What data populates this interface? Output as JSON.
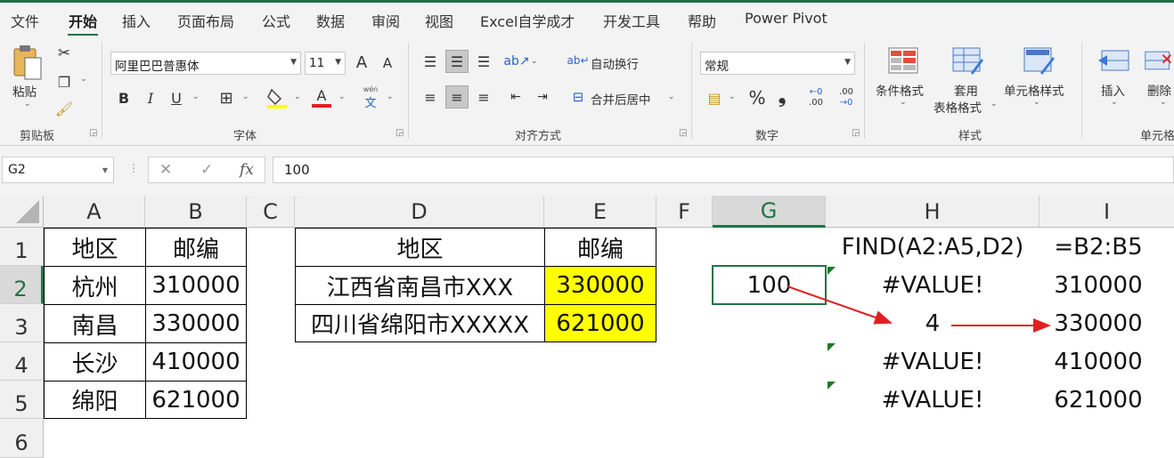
{
  "menu": {
    "items": [
      "文件",
      "开始",
      "插入",
      "页面布局",
      "公式",
      "数据",
      "审阅",
      "视图",
      "Excel自学成才",
      "开发工具",
      "帮助",
      "Power Pivot"
    ],
    "active": "开始"
  },
  "ribbon": {
    "clipboard": {
      "paste": "粘贴",
      "group": "剪贴板"
    },
    "font": {
      "name": "阿里巴巴普惠体",
      "size": "11",
      "grow": "A",
      "shrink": "A",
      "bold": "B",
      "italic": "I",
      "underline": "U",
      "phonetic": "wén",
      "phonetic_char": "文",
      "group": "字体"
    },
    "align": {
      "wrap": "自动换行",
      "merge": "合并后居中",
      "group": "对齐方式"
    },
    "number": {
      "format": "常规",
      "percent": "%",
      "comma": "❟",
      "inc": ".00",
      "dec": ".00",
      "group": "数字"
    },
    "styles": {
      "conditional": "条件格式",
      "table_1": "套用",
      "table_2": "表格格式",
      "cell_styles": "单元格样式",
      "group": "样式"
    },
    "cells": {
      "insert": "插入",
      "delete": "删除",
      "group": "单元格"
    }
  },
  "formula_bar": {
    "name_box": "G2",
    "cancel": "✕",
    "enter": "✓",
    "fx": "fx",
    "value": "100"
  },
  "columns": [
    "A",
    "B",
    "C",
    "D",
    "E",
    "F",
    "G",
    "H",
    "I"
  ],
  "rows": [
    "1",
    "2",
    "3",
    "4",
    "5",
    "6"
  ],
  "selected": {
    "column": "G",
    "row": "2"
  },
  "table1": {
    "headers": [
      "地区",
      "邮编"
    ],
    "rows": [
      [
        "杭州",
        "310000"
      ],
      [
        "南昌",
        "330000"
      ],
      [
        "长沙",
        "410000"
      ],
      [
        "绵阳",
        "621000"
      ]
    ]
  },
  "table2": {
    "headers": [
      "地区",
      "邮编"
    ],
    "rows": [
      [
        "江西省南昌市XXX",
        "330000"
      ],
      [
        "四川省绵阳市XXXXX",
        "621000"
      ]
    ]
  },
  "g2_value": "100",
  "h_col": [
    "FIND(A2:A5,D2)",
    "#VALUE!",
    "4",
    "#VALUE!",
    "#VALUE!"
  ],
  "i_col": [
    "=B2:B5",
    "310000",
    "330000",
    "410000",
    "621000"
  ],
  "colors": {
    "accent": "#217346",
    "highlight": "#ffff00",
    "arrow": "#e02020"
  }
}
